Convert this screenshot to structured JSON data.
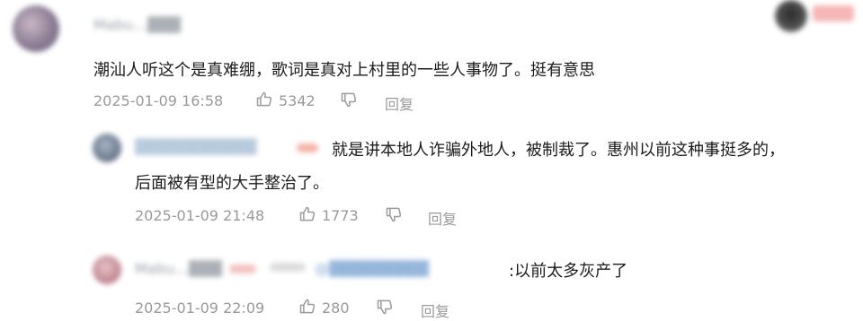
{
  "comments": [
    {
      "username": "Mabu…▓▓▓",
      "text": "潮汕人听这个是真难绷，歌词是真对上村里的一些人事物了。挺有意思",
      "timestamp": "2025-01-09 16:58",
      "likes": "5342",
      "reply_label": "回复"
    },
    {
      "username": "▓▓▓▓▓▓▓▓▓▓▓",
      "text_line1": "就是讲本地人诈骗外地人，被制裁了。惠州以前这种事挺多的，",
      "text_line2": "后面被有型的大手整治了。",
      "timestamp": "2025-01-09 21:48",
      "likes": "1773",
      "reply_label": "回复"
    },
    {
      "username": "Mabu…▓▓▓",
      "mention": "@▓▓▓▓▓▓▓▓▓",
      "text": ":以前太多灰产了",
      "timestamp": "2025-01-09 22:09",
      "likes": "280",
      "reply_label": "回复"
    }
  ],
  "icons": {
    "like": "thumb-up-icon",
    "dislike": "thumb-down-icon"
  },
  "colors": {
    "meta_text": "#9a9a9a",
    "body_text": "#1c1c1c"
  }
}
